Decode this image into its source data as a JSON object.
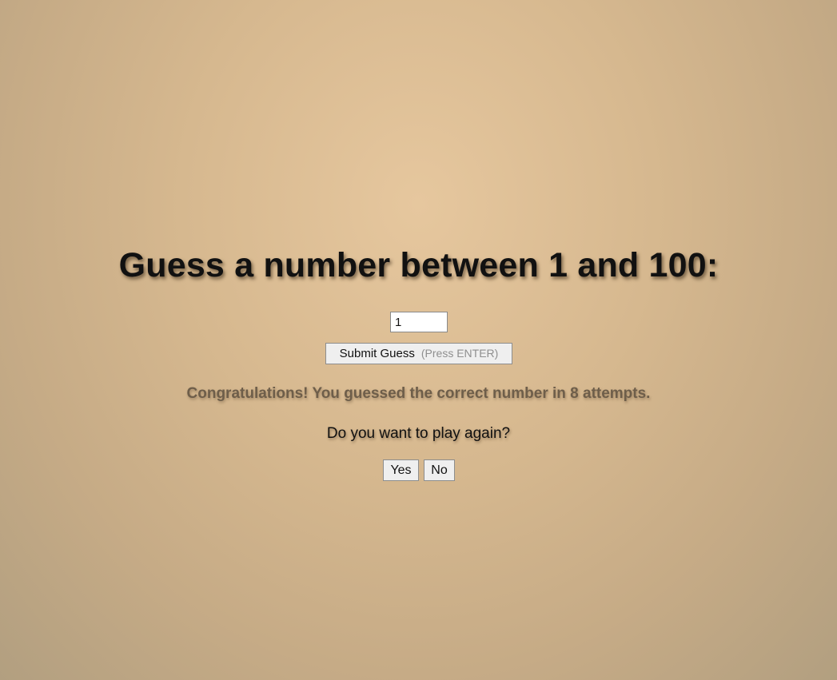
{
  "game": {
    "title": "Guess a number between 1 and 100:",
    "guess_input_value": "1",
    "submit_label": "Submit Guess",
    "submit_hint": "(Press ENTER)",
    "result_message": "Congratulations! You guessed the correct number in 8 attempts.",
    "play_again_question": "Do you want to play again?",
    "yes_label": "Yes",
    "no_label": "No"
  },
  "colors": {
    "background_center": "#e6c79e",
    "background_edge": "#b29f80",
    "title_text": "#111111",
    "message_text": "#6e5e4a"
  }
}
